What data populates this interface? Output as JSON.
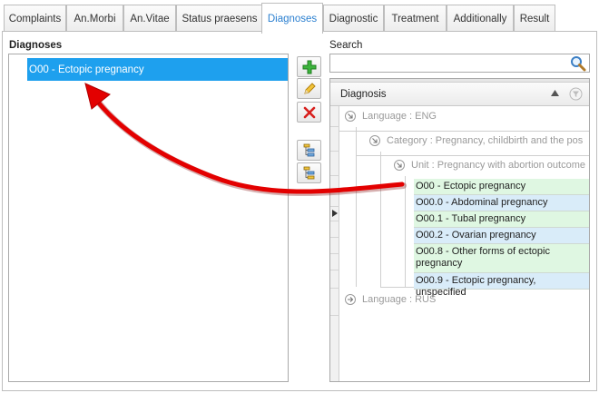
{
  "tabs": [
    {
      "label": "Complaints",
      "active": false
    },
    {
      "label": "An.Morbi",
      "active": false
    },
    {
      "label": "An.Vitae",
      "active": false
    },
    {
      "label": "Status praesens",
      "active": false
    },
    {
      "label": "Diagnoses",
      "active": true
    },
    {
      "label": "Diagnostic",
      "active": false
    },
    {
      "label": "Treatment",
      "active": false
    },
    {
      "label": "Additionally",
      "active": false
    },
    {
      "label": "Result",
      "active": false
    }
  ],
  "diagnoses_panel": {
    "label": "Diagnoses",
    "selected_item": "O00 - Ectopic pregnancy"
  },
  "toolbar": {
    "add_icon": "plus-icon",
    "edit_icon": "pencil-icon",
    "delete_icon": "delete-x-icon",
    "expand_icon": "tree-expand-icon",
    "collapse_icon": "tree-collapse-icon"
  },
  "search": {
    "label": "Search",
    "value": "",
    "icon": "magnifier-icon"
  },
  "catalog": {
    "column_header": "Diagnosis",
    "groups": {
      "language_eng": "Language : ENG",
      "category": "Category : Pregnancy, childbirth and the pos",
      "unit": "Unit : Pregnancy with abortion outcome",
      "language_rus": "Language : RUS"
    },
    "items": [
      {
        "text": "O00 - Ectopic pregnancy",
        "color": "green"
      },
      {
        "text": "O00.0 - Abdominal pregnancy",
        "color": "blue"
      },
      {
        "text": "O00.1 - Tubal pregnancy",
        "color": "green"
      },
      {
        "text": "O00.2 - Ovarian pregnancy",
        "color": "blue"
      },
      {
        "text": "O00.8 - Other forms of ectopic pregnancy",
        "color": "green"
      },
      {
        "text": "O00.9 - Ectopic pregnancy, unspecified",
        "color": "blue"
      }
    ]
  },
  "colors": {
    "accent": "#2a7fd0",
    "selection": "#1ea0ee",
    "row_green": "#dff7e2",
    "row_blue": "#d9ecf9",
    "arrow": "#e30000"
  }
}
